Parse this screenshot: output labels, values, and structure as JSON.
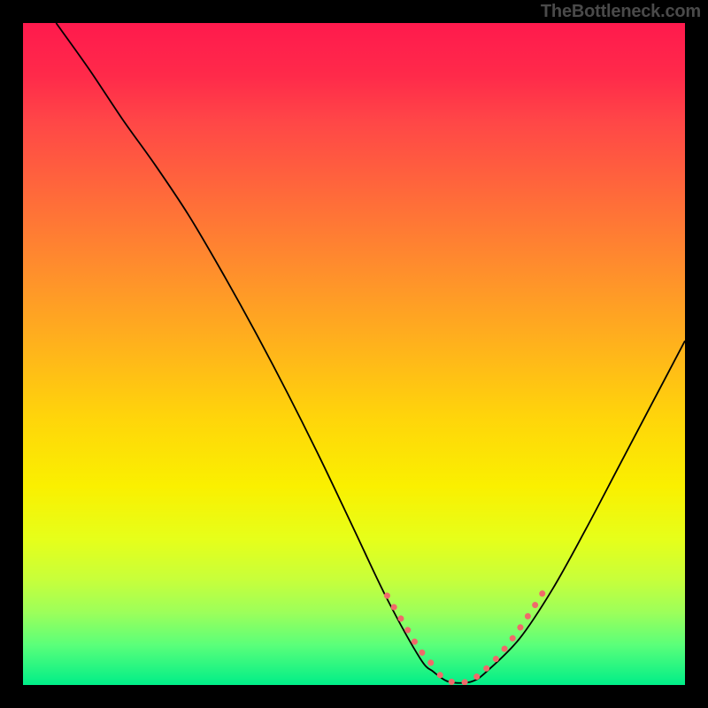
{
  "site_credit": "TheBottleneck.com",
  "chart_data": {
    "type": "line",
    "title": "",
    "xlabel": "",
    "ylabel": "",
    "xlim": [
      0,
      100
    ],
    "ylim": [
      0,
      100
    ],
    "curve": {
      "name": "bottleneck-curve",
      "x": [
        5,
        10,
        15,
        20,
        25,
        30,
        35,
        40,
        45,
        50,
        55,
        60,
        62,
        64,
        66,
        68,
        70,
        75,
        80,
        85,
        90,
        95,
        100
      ],
      "y": [
        100,
        93,
        85.5,
        78.5,
        71,
        62.5,
        53.5,
        44,
        34,
        23.5,
        13,
        4,
        2,
        0.6,
        0.3,
        0.6,
        2,
        7,
        14.5,
        23.5,
        33,
        42.5,
        52
      ]
    },
    "dotted_segments": [
      {
        "x": [
          55,
          56.5,
          58,
          59.5,
          61,
          62.5
        ],
        "y": [
          13.5,
          11,
          8.5,
          6,
          4,
          2.5
        ]
      },
      {
        "x": [
          63,
          64,
          65,
          66,
          67,
          68,
          69
        ],
        "y": [
          1.5,
          0.8,
          0.4,
          0.3,
          0.5,
          0.9,
          1.6
        ]
      },
      {
        "x": [
          70,
          71.5,
          73,
          74.5,
          76,
          77.5,
          79
        ],
        "y": [
          2.5,
          4,
          5.8,
          7.8,
          10,
          12.3,
          14.7
        ]
      }
    ]
  }
}
